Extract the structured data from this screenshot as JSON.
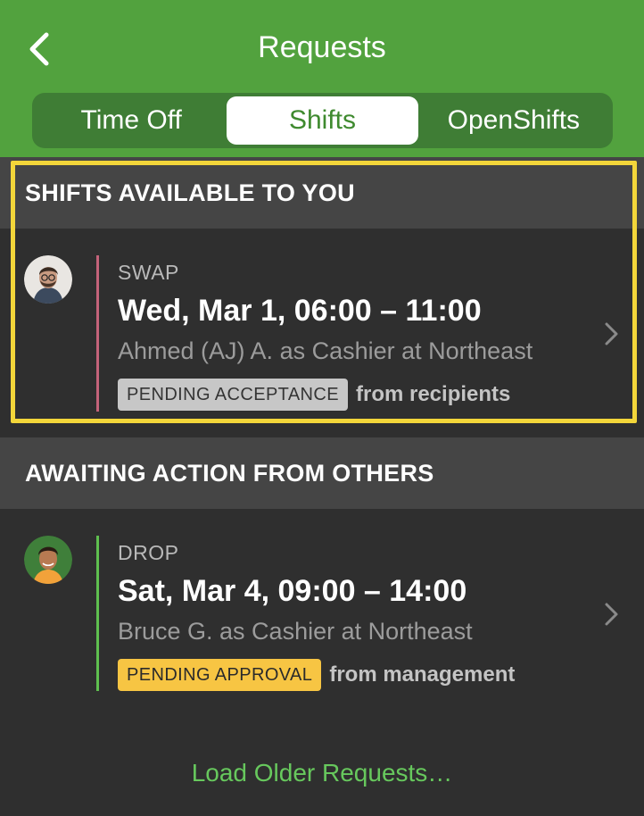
{
  "header": {
    "title": "Requests",
    "tabs": [
      {
        "label": "Time Off",
        "active": false
      },
      {
        "label": "Shifts",
        "active": true
      },
      {
        "label": "OpenShifts",
        "active": false
      }
    ]
  },
  "sections": [
    {
      "title": "SHIFTS AVAILABLE TO YOU",
      "requests": [
        {
          "type": "SWAP",
          "time": "Wed, Mar 1, 06:00 – 11:00",
          "who": "Ahmed (AJ) A. as Cashier at Northeast",
          "status": "PENDING ACCEPTANCE",
          "status_suffix": "from recipients",
          "bar_color": "#c4637a",
          "badge_color": "#c7c7c7"
        }
      ]
    },
    {
      "title": "AWAITING ACTION FROM OTHERS",
      "requests": [
        {
          "type": "DROP",
          "time": "Sat, Mar 4, 09:00 – 14:00",
          "who": "Bruce G. as Cashier at Northeast",
          "status": "PENDING APPROVAL",
          "status_suffix": "from management",
          "bar_color": "#5fbf4f",
          "badge_color": "#f7c543"
        }
      ]
    }
  ],
  "load_older": "Load Older Requests…",
  "colors": {
    "header_green": "#52a23e",
    "highlight_yellow": "#f3d63a",
    "link_green": "#67c85d"
  }
}
